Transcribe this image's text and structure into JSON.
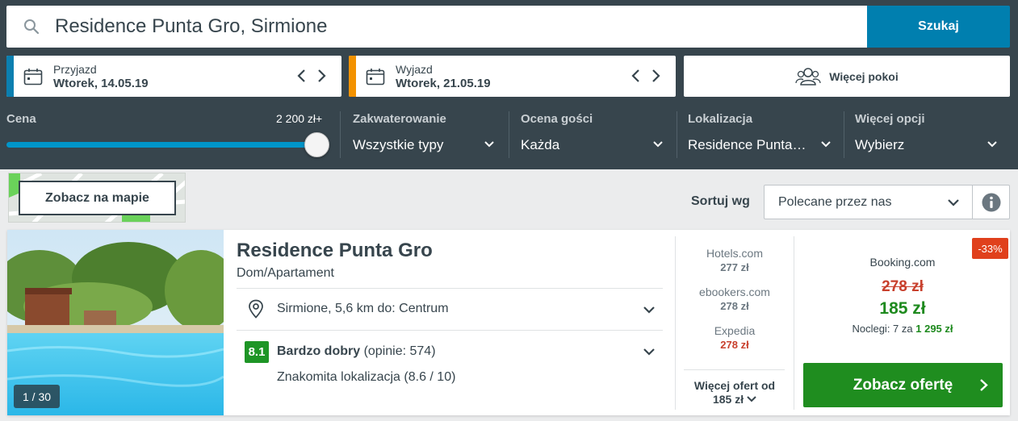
{
  "search": {
    "value": "Residence Punta Gro, Sirmione",
    "button_label": "Szukaj"
  },
  "checkin": {
    "label": "Przyjazd",
    "value": "Wtorek, 14.05.19",
    "accent": "#0b7fb0"
  },
  "checkout": {
    "label": "Wyjazd",
    "value": "Wtorek, 21.05.19",
    "accent": "#f39200"
  },
  "rooms": {
    "label": "Więcej pokoi",
    "icon": "people-icon"
  },
  "filters": {
    "price": {
      "label": "Cena",
      "max_label": "2 200 zł+",
      "level_percent": 100
    },
    "accommodation": {
      "label": "Zakwaterowanie",
      "value": "Wszystkie typy"
    },
    "guest_rating": {
      "label": "Ocena gości",
      "value": "Każda"
    },
    "location": {
      "label": "Lokalizacja",
      "value": "Residence Punta…"
    },
    "more": {
      "label": "Więcej opcji",
      "value": "Wybierz"
    }
  },
  "map": {
    "button_label": "Zobacz na mapie"
  },
  "sort": {
    "label": "Sortuj wg",
    "value": "Polecane przez nas"
  },
  "hotel": {
    "name": "Residence Punta Gro",
    "type": "Dom/Apartament",
    "photo_counter": "1 / 30",
    "location": "Sirmione, 5,6 km do: Centrum",
    "rating": {
      "score": "8.1",
      "label": "Bardzo dobry",
      "reviews": "(opinie: 574)",
      "sub": "Znakomita lokalizacja (8.6 / 10)"
    },
    "alt_offers": [
      {
        "provider": "Hotels.com",
        "price": "277 zł"
      },
      {
        "provider": "ebookers.com",
        "price": "278 zł"
      },
      {
        "provider": "Expedia",
        "price": "278 zł"
      }
    ],
    "more_offers": {
      "line1": "Więcej ofert od",
      "line2": "185 zł"
    },
    "best": {
      "discount": "-33%",
      "provider": "Booking.com",
      "old_price": "278 zł",
      "new_price": "185 zł",
      "nights_prefix": "Noclegi: 7 za",
      "nights_total": "1 295 zł",
      "cta": "Zobacz ofertę"
    }
  },
  "colors": {
    "header_bg": "#37454d",
    "search_button": "#007faf",
    "rating_green": "#1e9526",
    "cta_green": "#1f8d1f",
    "price_red": "#c8402d",
    "discount_red": "#e0401c"
  }
}
